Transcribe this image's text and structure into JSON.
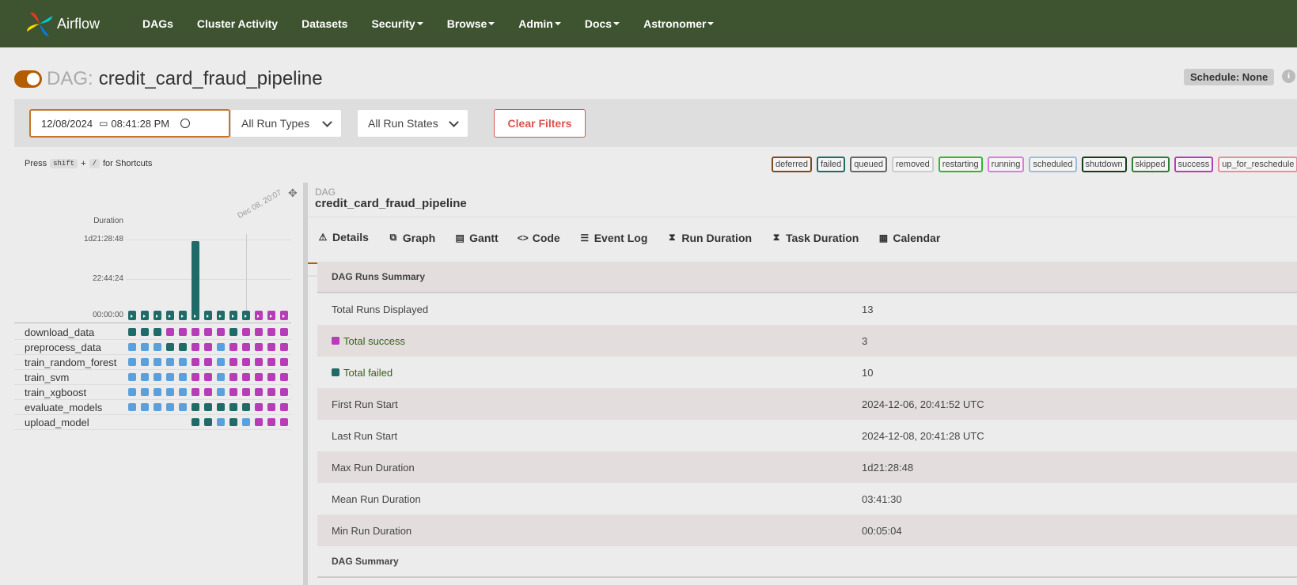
{
  "navbar": {
    "brand": "Airflow",
    "items": [
      {
        "label": "DAGs",
        "dropdown": false
      },
      {
        "label": "Cluster Activity",
        "dropdown": false
      },
      {
        "label": "Datasets",
        "dropdown": false
      },
      {
        "label": "Security",
        "dropdown": true
      },
      {
        "label": "Browse",
        "dropdown": true
      },
      {
        "label": "Admin",
        "dropdown": true
      },
      {
        "label": "Docs",
        "dropdown": true
      },
      {
        "label": "Astronomer",
        "dropdown": true
      }
    ]
  },
  "dag": {
    "prefix": "DAG:",
    "name": "credit_card_fraud_pipeline",
    "schedule": "Schedule: None",
    "info_icon": "i"
  },
  "filters": {
    "date": "12/08/2024",
    "time": "08:41:28 PM",
    "run_types": "All Run Types",
    "run_states": "All Run States",
    "clear": "Clear Filters"
  },
  "shortcuts": {
    "press": "Press",
    "key1": "shift",
    "plus": "+",
    "key2": "/",
    "for": "for Shortcuts"
  },
  "legend": [
    {
      "label": "deferred",
      "color": "#7b4a20"
    },
    {
      "label": "failed",
      "color": "#1e6b68"
    },
    {
      "label": "queued",
      "color": "#666666"
    },
    {
      "label": "removed",
      "color": "#cccccc"
    },
    {
      "label": "restarting",
      "color": "#2db82d"
    },
    {
      "label": "running",
      "color": "#e07ae0"
    },
    {
      "label": "scheduled",
      "color": "#9fbbd8"
    },
    {
      "label": "shutdown",
      "color": "#153d1d"
    },
    {
      "label": "skipped",
      "color": "#2e7d32"
    },
    {
      "label": "success",
      "color": "#b73cb7"
    },
    {
      "label": "up_for_reschedule",
      "color": "#e88e9f"
    }
  ],
  "grid": {
    "duration_label": "Duration",
    "ticks": [
      "1d21:28:48",
      "22:44:24",
      "00:00:00"
    ],
    "date_marker": "Dec 08, 20:07",
    "collapse_icon": "compress-icon",
    "runs": [
      {
        "state": "failed",
        "duration_fraction": 0.03
      },
      {
        "state": "failed",
        "duration_fraction": 0.03
      },
      {
        "state": "failed",
        "duration_fraction": 0.03
      },
      {
        "state": "failed",
        "duration_fraction": 0.03
      },
      {
        "state": "failed",
        "duration_fraction": 0.03
      },
      {
        "state": "failed",
        "duration_fraction": 1.0
      },
      {
        "state": "failed",
        "duration_fraction": 0.03
      },
      {
        "state": "failed",
        "duration_fraction": 0.03
      },
      {
        "state": "failed",
        "duration_fraction": 0.03
      },
      {
        "state": "failed",
        "duration_fraction": 0.03
      },
      {
        "state": "success",
        "duration_fraction": 0.03
      },
      {
        "state": "success",
        "duration_fraction": 0.03
      },
      {
        "state": "success",
        "duration_fraction": 0.03
      }
    ],
    "tasks": [
      {
        "name": "download_data",
        "cells": [
          "F",
          "F",
          "F",
          "S",
          "S",
          "S",
          "S",
          "S",
          "F",
          "S",
          "S",
          "S",
          "S"
        ]
      },
      {
        "name": "preprocess_data",
        "cells": [
          "U",
          "U",
          "U",
          "F",
          "F",
          "S",
          "S",
          "U",
          "S",
          "S",
          "S",
          "S",
          "S"
        ]
      },
      {
        "name": "train_random_forest",
        "cells": [
          "U",
          "U",
          "U",
          "U",
          "U",
          "S",
          "S",
          "U",
          "S",
          "S",
          "S",
          "S",
          "S"
        ]
      },
      {
        "name": "train_svm",
        "cells": [
          "U",
          "U",
          "U",
          "U",
          "U",
          "S",
          "S",
          "U",
          "S",
          "S",
          "S",
          "S",
          "S"
        ]
      },
      {
        "name": "train_xgboost",
        "cells": [
          "U",
          "U",
          "U",
          "U",
          "U",
          "S",
          "S",
          "U",
          "S",
          "S",
          "S",
          "S",
          "S"
        ]
      },
      {
        "name": "evaluate_models",
        "cells": [
          "U",
          "U",
          "U",
          "U",
          "U",
          "F",
          "F",
          "F",
          "F",
          "F",
          "S",
          "S",
          "S"
        ]
      },
      {
        "name": "upload_model",
        "cells": [
          "",
          "",
          "",
          "",
          "",
          "F",
          "F",
          "U",
          "F",
          "U",
          "S",
          "S",
          "S"
        ]
      }
    ]
  },
  "content": {
    "small_label": "DAG",
    "title": "credit_card_fraud_pipeline",
    "tabs": [
      {
        "label": "Details",
        "icon": "warning-icon",
        "glyph": "⚠",
        "active": true
      },
      {
        "label": "Graph",
        "icon": "graph-icon",
        "glyph": "⧉",
        "active": false
      },
      {
        "label": "Gantt",
        "icon": "gantt-icon",
        "glyph": "▤",
        "active": false
      },
      {
        "label": "Code",
        "icon": "code-icon",
        "glyph": "<>",
        "active": false
      },
      {
        "label": "Event Log",
        "icon": "event-log-icon",
        "glyph": "☰",
        "active": false
      },
      {
        "label": "Run Duration",
        "icon": "hourglass-icon",
        "glyph": "⧗",
        "active": false
      },
      {
        "label": "Task Duration",
        "icon": "hourglass-icon",
        "glyph": "⧗",
        "active": false
      },
      {
        "label": "Calendar",
        "icon": "calendar-icon",
        "glyph": "▦",
        "active": false
      }
    ],
    "summary": {
      "heading": "DAG Runs Summary",
      "rows": [
        {
          "key": "Total Runs Displayed",
          "value": "13"
        },
        {
          "key": "Total success",
          "value": "3",
          "swatch": "#b73cb7"
        },
        {
          "key": "Total failed",
          "value": "10",
          "swatch": "#1e6b68"
        },
        {
          "key": "First Run Start",
          "value": "2024-12-06, 20:41:52 UTC"
        },
        {
          "key": "Last Run Start",
          "value": "2024-12-08, 20:41:28 UTC"
        },
        {
          "key": "Max Run Duration",
          "value": "1d21:28:48"
        },
        {
          "key": "Mean Run Duration",
          "value": "03:41:30"
        },
        {
          "key": "Min Run Duration",
          "value": "00:05:04"
        }
      ],
      "heading2": "DAG Summary"
    }
  },
  "colors": {
    "nav": "#3e5330",
    "failed": "#1e6b68",
    "success": "#b73cb7",
    "upstream": "#5aa0dc"
  }
}
